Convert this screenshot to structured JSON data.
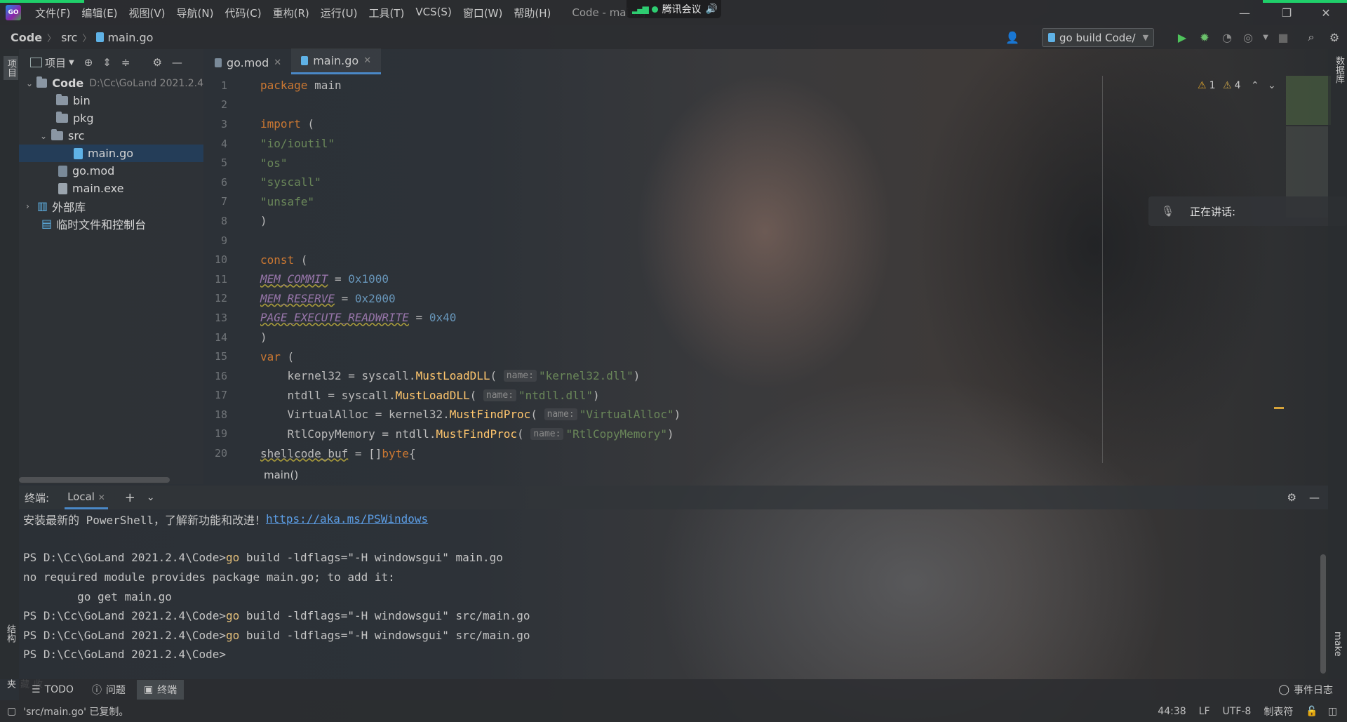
{
  "menubar": {
    "logo": "GO",
    "items": [
      "文件(F)",
      "编辑(E)",
      "视图(V)",
      "导航(N)",
      "代码(C)",
      "重构(R)",
      "运行(U)",
      "工具(T)",
      "VCS(S)",
      "窗口(W)",
      "帮助(H)"
    ],
    "window_title": "Code - main.g",
    "meeting_label": "腾讯会议"
  },
  "navbar": {
    "crumbs": [
      "Code",
      "src",
      "main.go"
    ],
    "run_config": "go build Code/"
  },
  "left_strip": {
    "project_label": "项目",
    "structure_label": "结构",
    "favorites_label": "收藏夹"
  },
  "right_strip": {
    "database_label": "数据库",
    "make_label": "make"
  },
  "project": {
    "view_label": "项目",
    "tree": [
      {
        "name": "Code",
        "hint": "D:\\Cc\\GoLand 2021.2.4",
        "type": "folder",
        "depth": 0,
        "expanded": true
      },
      {
        "name": "bin",
        "type": "folder",
        "depth": 1
      },
      {
        "name": "pkg",
        "type": "folder",
        "depth": 1
      },
      {
        "name": "src",
        "type": "folder",
        "depth": 1,
        "expanded": true
      },
      {
        "name": "main.go",
        "type": "go",
        "depth": 2,
        "selected": true
      },
      {
        "name": "go.mod",
        "type": "mod",
        "depth": 1
      },
      {
        "name": "main.exe",
        "type": "exe",
        "depth": 1
      },
      {
        "name": "外部库",
        "type": "lib",
        "depth": 0
      },
      {
        "name": "临时文件和控制台",
        "type": "scratch",
        "depth": 0
      }
    ]
  },
  "editor": {
    "tabs": [
      {
        "label": "go.mod",
        "active": false
      },
      {
        "label": "main.go",
        "active": true
      }
    ],
    "warnings": {
      "errors": "1",
      "warnings": "4"
    },
    "line_numbers": [
      "1",
      "2",
      "3",
      "4",
      "5",
      "6",
      "7",
      "8",
      "9",
      "10",
      "11",
      "12",
      "13",
      "14",
      "15",
      "16",
      "17",
      "18",
      "19",
      "20"
    ],
    "breadcrumb": "main()"
  },
  "meeting_popup": {
    "label": "正在讲话:"
  },
  "terminal": {
    "title": "终端:",
    "tab": "Local",
    "lines": {
      "l1_text": "安装最新的 PowerShell，了解新功能和改进！",
      "l1_link": "https://aka.ms/PSWindows",
      "prompt": "PS D:\\Cc\\GoLand 2021.2.4\\Code>",
      "cmd1_go": "go",
      "cmd1_rest": " build -ldflags=\"-H windowsgui\" main.go",
      "err1": "no required module provides package main.go; to add it:",
      "err2": "        go get main.go",
      "cmd2_rest": " build -ldflags=\"-H windowsgui\" src/main.go",
      "cmd3_rest": " build -ldflags=\"-H windowsgui\" src/main.go"
    }
  },
  "tool_windows": {
    "todo": "TODO",
    "problems": "问题",
    "terminal": "终端",
    "event_log": "事件日志"
  },
  "status": {
    "message": "'src/main.go' 已复制。",
    "position": "44:38",
    "line_sep": "LF",
    "encoding": "UTF-8",
    "indent": "制表符"
  }
}
